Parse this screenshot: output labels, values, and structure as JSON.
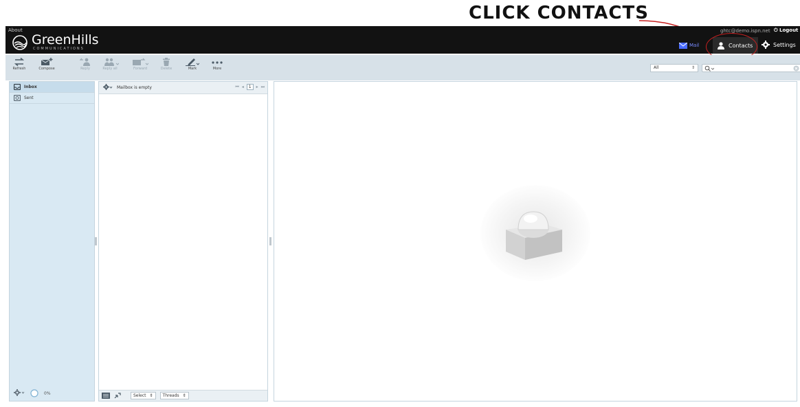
{
  "annotation": {
    "text": "CLICK CONTACTS"
  },
  "topbar": {
    "about": "About",
    "brand": "GreenHills",
    "brand_sub": "COMMUNICATIONS",
    "user_email": "ghtc@demo.ispn.net",
    "logout": "Logout",
    "nav": {
      "mail": "Mail",
      "contacts": "Contacts",
      "settings": "Settings"
    }
  },
  "toolbar": {
    "refresh": "Refresh",
    "compose": "Compose",
    "reply": "Reply",
    "reply_all": "Reply all",
    "forward": "Forward",
    "delete": "Delete",
    "mark": "Mark",
    "more": "More",
    "filter_value": "All",
    "search_placeholder": ""
  },
  "folders": {
    "items": [
      {
        "label": "Inbox",
        "icon": "inbox-icon",
        "selected": true
      },
      {
        "label": "Sent",
        "icon": "sent-icon",
        "selected": false
      }
    ],
    "quota": "0%"
  },
  "messages": {
    "status": "Mailbox is empty",
    "page": "1",
    "select_label": "Select",
    "threads_label": "Threads"
  },
  "colors": {
    "topbar_bg": "#121212",
    "toolbar_bg": "#d7e1e8",
    "folders_bg": "#d9e9f3",
    "annotation_red": "#c62020",
    "mail_accent": "#7a8cff"
  }
}
